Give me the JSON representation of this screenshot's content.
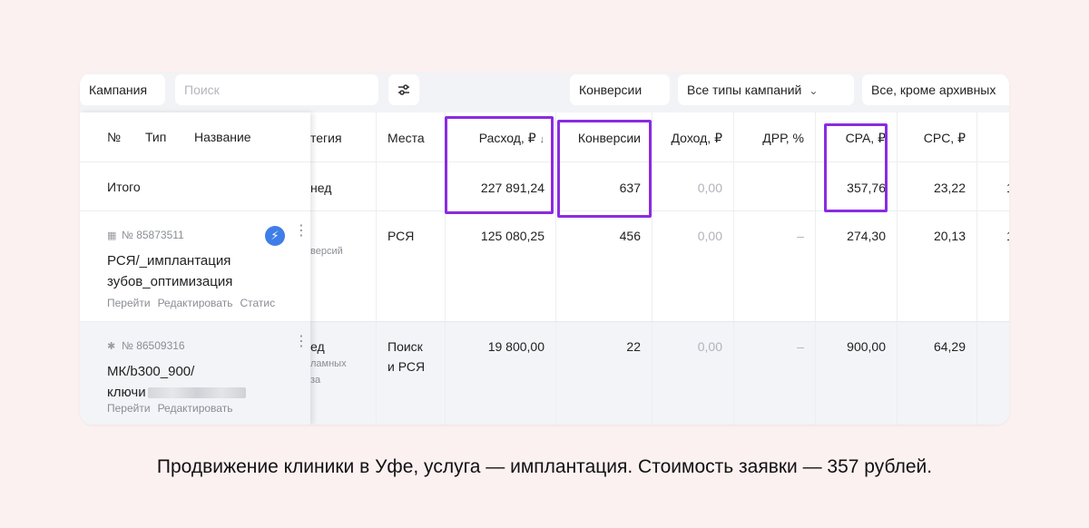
{
  "toolbar": {
    "campaign_label": "Кампания",
    "search_placeholder": "Поиск",
    "conversions_button": "Конверсии",
    "campaign_types_select": "Все типы кампаний",
    "archive_select": "Все, кроме архивных"
  },
  "headers": {
    "num": "№",
    "type": "Тип",
    "name": "Название",
    "strategy": "тегия",
    "places": "Места",
    "spend": "Расход, ₽",
    "sort_indicator": "↓",
    "conversions": "Конверсии",
    "income": "Доход, ₽",
    "drr": "ДРР, %",
    "cpa": "CPA, ₽",
    "cpc": "CPC, ₽"
  },
  "total": {
    "label": "Итого",
    "strategy": "нед",
    "spend": "227 891,24",
    "conversions": "637",
    "income": "0,00",
    "cpa": "357,76",
    "cpc": "23,22",
    "overflow": "1"
  },
  "rows": [
    {
      "id": "№ 85873511",
      "name_line1": "РСЯ/_имплантация",
      "name_line2": "зубов_оптимизация",
      "actions": [
        "Перейти",
        "Редактировать",
        "Статис"
      ],
      "strategy_top": "",
      "strategy_sub": "версий",
      "places": "РСЯ",
      "places2": "",
      "spend": "125 080,25",
      "conversions": "456",
      "income": "0,00",
      "drr": "–",
      "cpa": "274,30",
      "cpc": "20,13",
      "overflow": "1"
    },
    {
      "id": "№ 86509316",
      "name_line1": "МК/b300_900/",
      "name_line2": "ключи",
      "actions": [
        "Перейти",
        "Редактировать"
      ],
      "strategy_top": "ед",
      "strategy_sub": "ламных\nза",
      "places": "Поиск",
      "places2": "и РСЯ",
      "spend": "19 800,00",
      "conversions": "22",
      "income": "0,00",
      "drr": "–",
      "cpa": "900,00",
      "cpc": "64,29",
      "overflow": ""
    }
  ],
  "caption": "Продвижение клиники в Уфе, услуга — имплантация. Стоимость заявки — 357 рублей.",
  "colors": {
    "highlight": "#8a2be2",
    "background": "#fcf1f1",
    "badge": "#3f7ee8"
  },
  "icons": {
    "badge": "lightning-icon",
    "kebab": "kebab-menu-icon",
    "filter": "filter-sliders-icon"
  }
}
